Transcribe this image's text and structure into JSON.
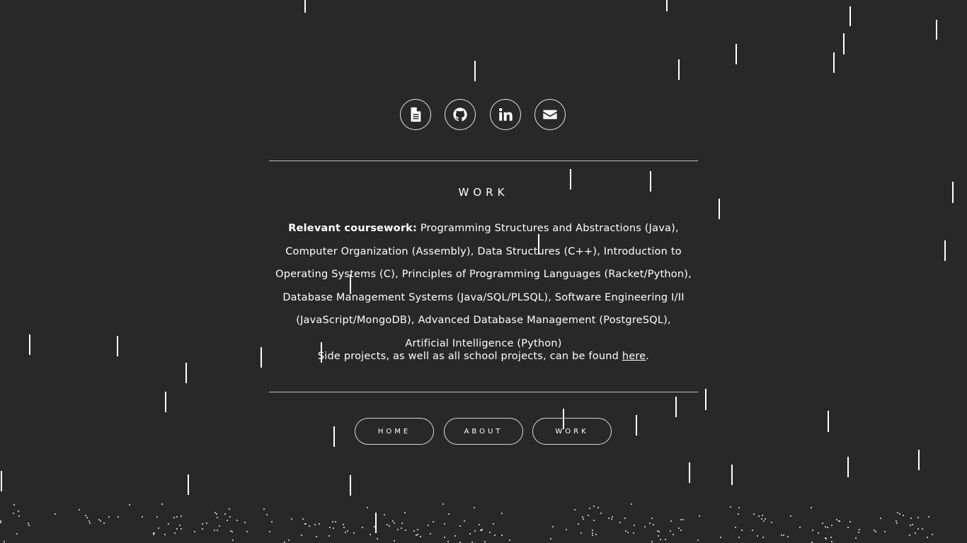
{
  "social": {
    "icons": [
      "document-icon",
      "github-icon",
      "linkedin-icon",
      "envelope-icon"
    ]
  },
  "section": {
    "title": "WORK",
    "coursework_label": "Relevant coursework:",
    "coursework_text": " Programming Structures and Abstractions (Java), Computer Organization (Assembly), Data Structures (C++), Introduction to Operating Systems (C), Principles of Programming Languages (Racket/Python), Database Management Systems (Java/SQL/PLSQL), Software Engineering I/II (JavaScript/MongoDB), Advanced Database Management (PostgreSQL), Artificial Intelligence (Python)",
    "projects_prefix": "Side projects, as well as all school projects, can be found ",
    "projects_link": "here",
    "projects_suffix": "."
  },
  "nav": {
    "home": "HOME",
    "about": "ABOUT",
    "work": "WORK"
  },
  "colors": {
    "background": "#282828",
    "foreground": "#ffffff",
    "rule": "#bdbdbd"
  }
}
